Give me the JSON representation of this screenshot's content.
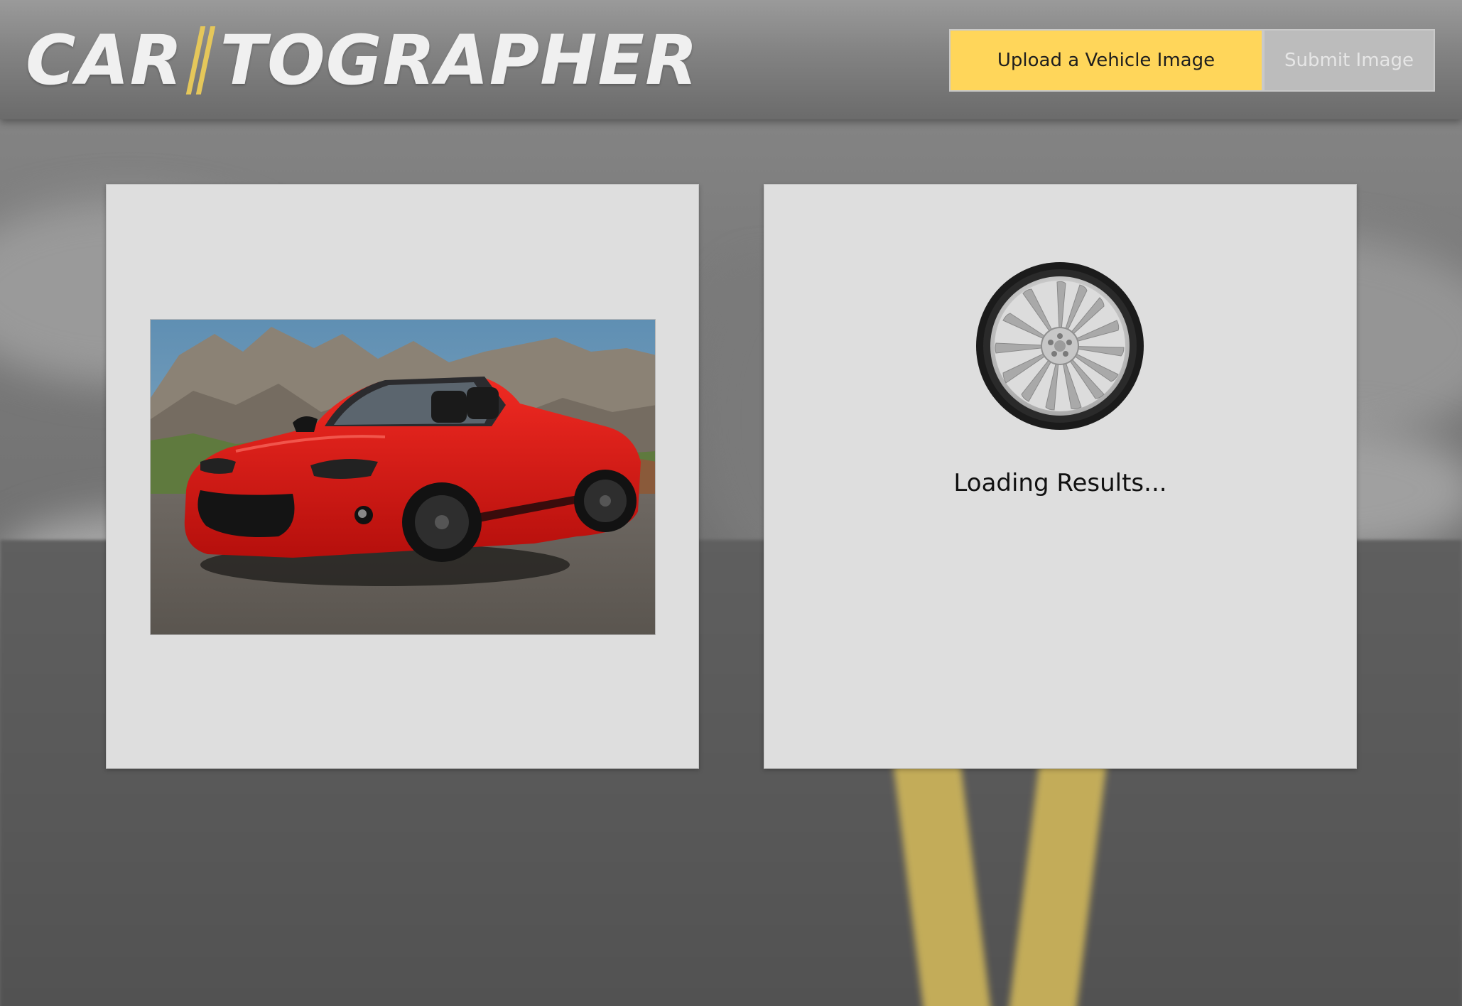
{
  "app": {
    "logo_part1": "CAR",
    "logo_part2": "TOGRAPHER",
    "logo_accent_color": "#e5c75a"
  },
  "header": {
    "upload_label": "Upload a Vehicle Image",
    "submit_label": "Submit Image",
    "upload_color": "#ffd65a",
    "submit_state": "disabled"
  },
  "preview": {
    "image_subject": "red convertible sports car in front of mountains"
  },
  "results": {
    "spinner_icon": "wheel-icon",
    "loading_text": "Loading Results..."
  }
}
